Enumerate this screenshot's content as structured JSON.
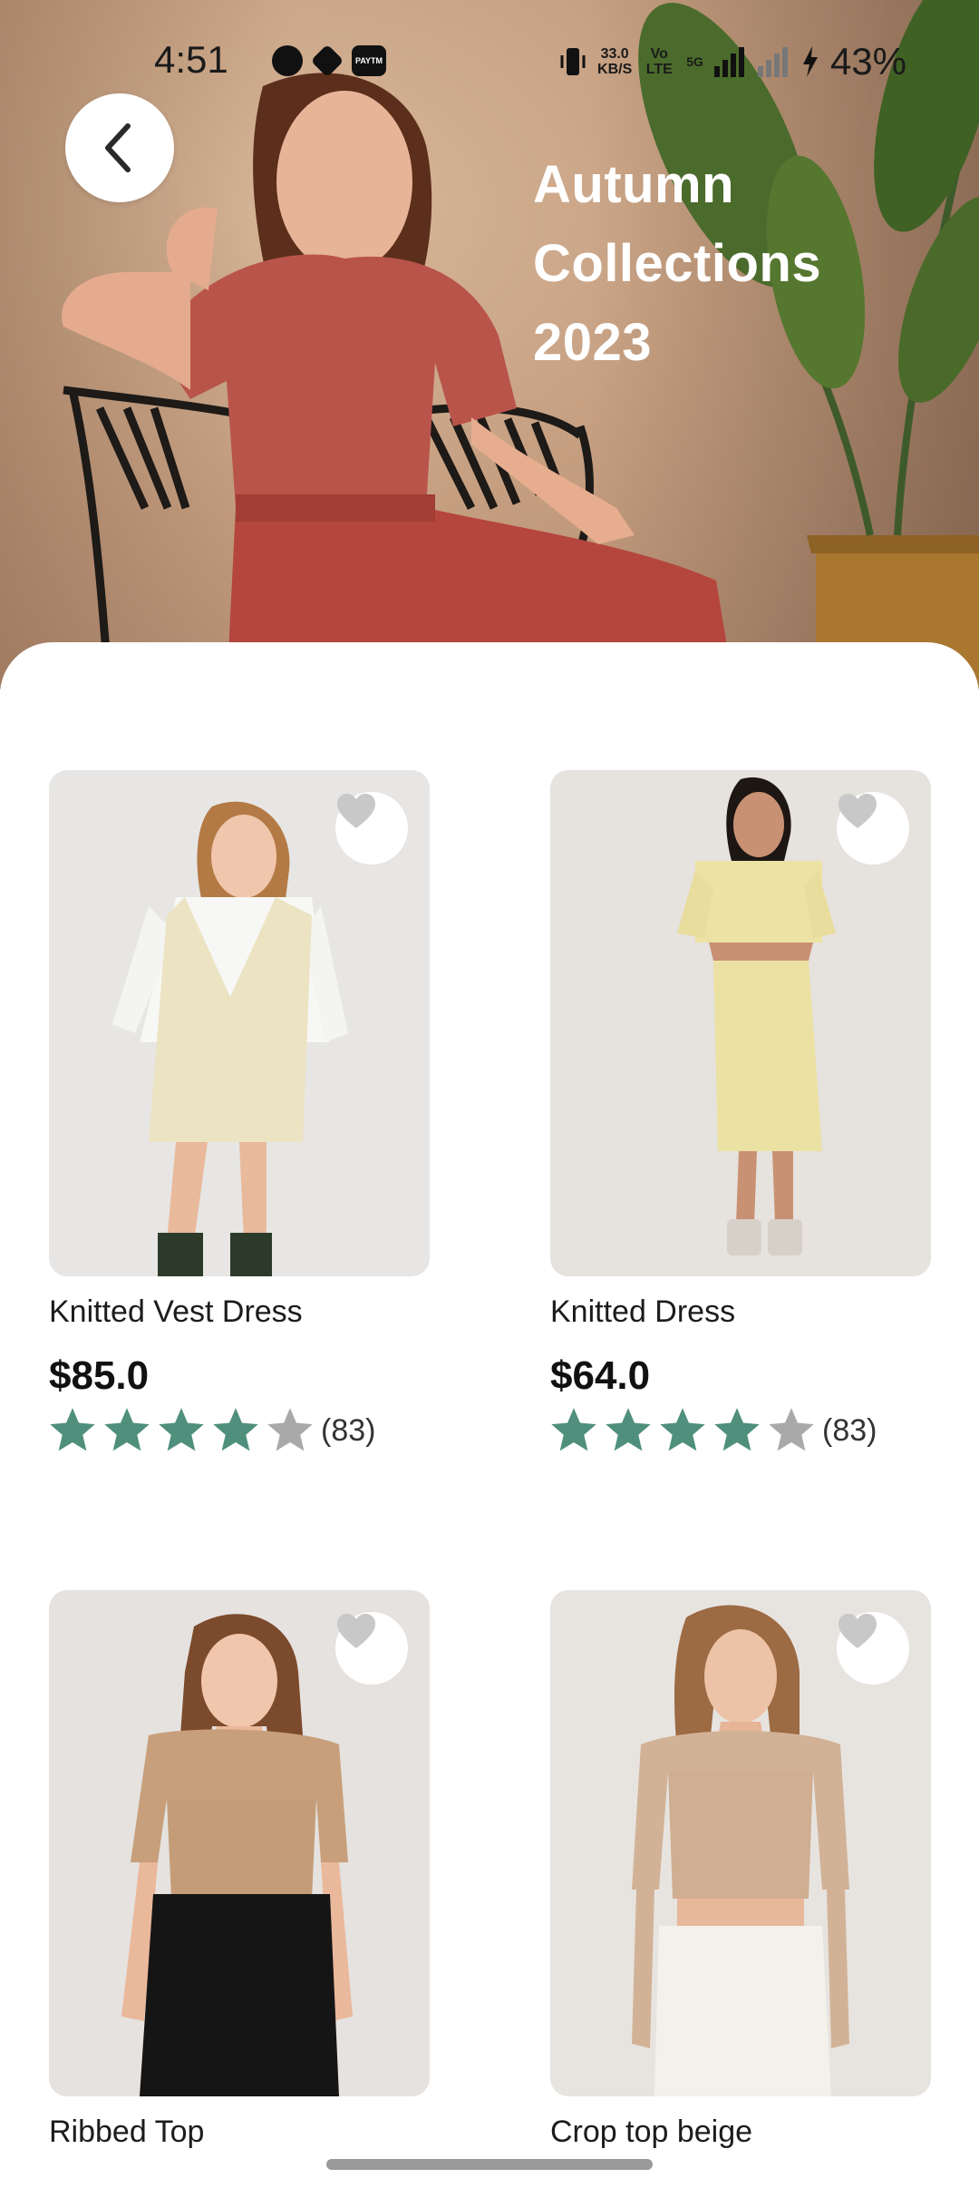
{
  "status_bar": {
    "time": "4:51",
    "net_speed": "33.0",
    "net_unit": "KB/S",
    "volte": "Vo LTE",
    "network": "5G",
    "battery": "43%",
    "paytm": "PAYTM"
  },
  "hero": {
    "title_lines": [
      "Autumn",
      "Collections",
      "2023"
    ]
  },
  "colors": {
    "star_filled": "#4f8f7c",
    "star_empty": "#a9a9a9",
    "fav_heart": "#c8c8c8"
  },
  "products": [
    {
      "name": "Knitted Vest Dress",
      "price": "$85.0",
      "rating": 4,
      "reviews": "(83)"
    },
    {
      "name": "Knitted Dress",
      "price": "$64.0",
      "rating": 4,
      "reviews": "(83)"
    },
    {
      "name": "Ribbed Top",
      "price": "",
      "rating": 0,
      "reviews": ""
    },
    {
      "name": "Crop top beige",
      "price": "",
      "rating": 0,
      "reviews": ""
    }
  ]
}
